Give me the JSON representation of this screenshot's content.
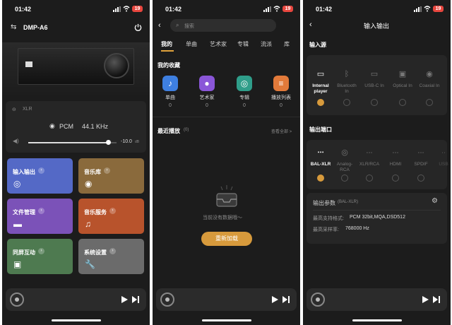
{
  "status": {
    "time": "01:42",
    "battery": "19"
  },
  "screen1": {
    "device_name": "DMP-A6",
    "output_label": "XLR",
    "format": "PCM",
    "sample_rate": "44.1 KHz",
    "volume": "-10.0",
    "volume_unit": "dB",
    "volume_level": 0.9,
    "tiles": [
      {
        "label": "输入输出",
        "color": "#5469c6",
        "icon": "target-icon"
      },
      {
        "label": "音乐库",
        "color": "#8a6a3c",
        "icon": "disc-icon"
      },
      {
        "label": "文件管理",
        "color": "#7b52b8",
        "icon": "folder-icon"
      },
      {
        "label": "音乐服务",
        "color": "#b8532c",
        "icon": "music-note-icon"
      },
      {
        "label": "同屏互动",
        "color": "#4e7a50",
        "icon": "screens-icon"
      },
      {
        "label": "系统设置",
        "color": "#6b6b6b",
        "icon": "wrench-icon"
      }
    ]
  },
  "screen2": {
    "search_placeholder": "搜索",
    "tabs": [
      "我的",
      "单曲",
      "艺术家",
      "专辑",
      "流派",
      "库"
    ],
    "favorites_title": "我的收藏",
    "favorites": [
      {
        "label": "单曲",
        "count": "0",
        "color": "#3e7fe0",
        "icon": "music-note-icon"
      },
      {
        "label": "艺术家",
        "count": "0",
        "color": "#8a56d8",
        "icon": "microphone-icon"
      },
      {
        "label": "专辑",
        "count": "0",
        "color": "#2f9e8a",
        "icon": "album-icon"
      },
      {
        "label": "播放列表",
        "count": "0",
        "color": "#e27a3a",
        "icon": "playlist-icon"
      }
    ],
    "recent_title": "最近播放",
    "recent_count": "(0)",
    "view_all": "查看全部 >",
    "empty_text": "当前没有数据哦～",
    "reload_label": "重新加载"
  },
  "screen3": {
    "title": "输入输出",
    "input_title": "输入源",
    "inputs": [
      {
        "label": "Internal player",
        "selected": true
      },
      {
        "label": "Bluetooth In",
        "selected": false
      },
      {
        "label": "USB-C In",
        "selected": false
      },
      {
        "label": "Optical In",
        "selected": false
      },
      {
        "label": "Coaxial In",
        "selected": false
      }
    ],
    "output_title": "输出端口",
    "outputs": [
      {
        "label": "BAL-XLR",
        "selected": true
      },
      {
        "label": "Analog-RCA",
        "selected": false
      },
      {
        "label": "XLR/RCA",
        "selected": false
      },
      {
        "label": "HDMI",
        "selected": false
      },
      {
        "label": "SPDIF",
        "selected": false
      },
      {
        "label": "USB",
        "selected": false
      }
    ],
    "params_title": "输出参数",
    "params_sub": "(BAL-XLR)",
    "max_format_label": "最高支持格式:",
    "max_format_value": "PCM 32bit,MQA,DSD512",
    "max_rate_label": "最高采样率:",
    "max_rate_value": "768000 Hz"
  }
}
